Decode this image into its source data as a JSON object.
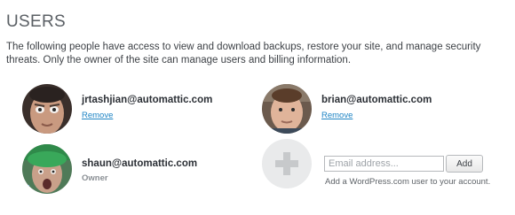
{
  "section": {
    "title": "USERS",
    "description": "The following people have access to view and download backups, restore your site, and manage security threats. Only the owner of the site can manage users and billing information."
  },
  "users": [
    {
      "email": "jrtashjian@automattic.com",
      "action_label": "Remove"
    },
    {
      "email": "brian@automattic.com",
      "action_label": "Remove"
    },
    {
      "email": "shaun@automattic.com",
      "role_label": "Owner"
    }
  ],
  "add_user": {
    "placeholder": "Email address...",
    "button_label": "Add",
    "hint": "Add a WordPress.com user to your account."
  },
  "colors": {
    "link": "#1e84c4",
    "title": "#5a5f64",
    "text": "#3d4146",
    "owner_label": "#8a8f94",
    "add_circle_bg": "#e9eaeb",
    "add_circle_plus": "#c7c9cb"
  }
}
